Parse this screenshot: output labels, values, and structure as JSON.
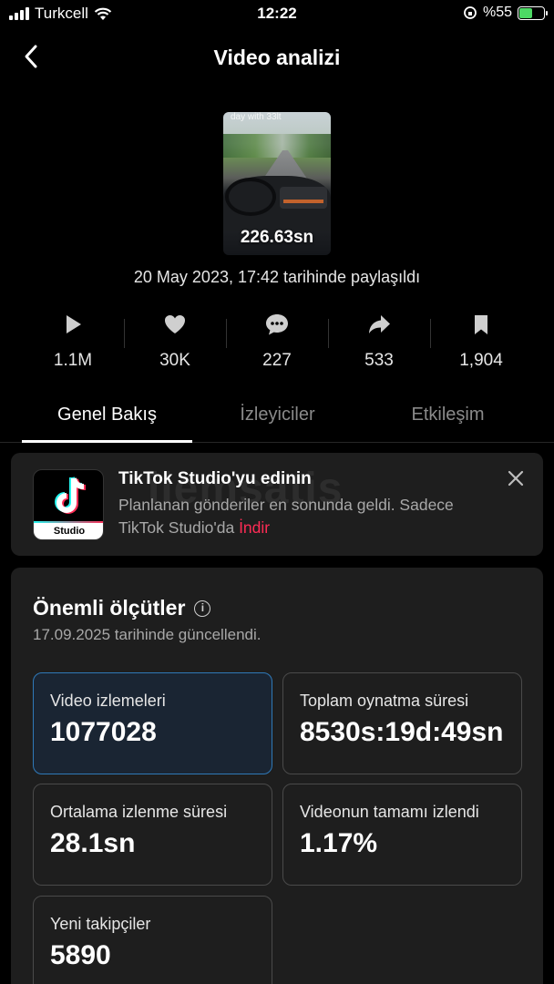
{
  "status_bar": {
    "carrier": "Turkcell",
    "time": "12:22",
    "battery": "%55"
  },
  "header": {
    "title": "Video analizi"
  },
  "video": {
    "overlay_text": "day with 33lt",
    "duration": "226.63sn",
    "shared_text": "20 May 2023, 17:42 tarihinde paylaşıldı"
  },
  "stats": [
    {
      "icon": "play-icon",
      "value": "1.1M"
    },
    {
      "icon": "heart-icon",
      "value": "30K"
    },
    {
      "icon": "comment-icon",
      "value": "227"
    },
    {
      "icon": "share-icon",
      "value": "533"
    },
    {
      "icon": "bookmark-icon",
      "value": "1,904"
    }
  ],
  "tabs": [
    "Genel Bakış",
    "İzleyiciler",
    "Etkileşim"
  ],
  "banner": {
    "logo_label": "Studio",
    "title": "TikTok Studio'yu edinin",
    "text": "Planlanan gönderiler en sonunda geldi. Sadece TikTok Studio'da ",
    "link": "İndir",
    "watermark": "ilemsatis"
  },
  "metrics": {
    "title": "Önemli ölçütler",
    "updated": "17.09.2025 tarihinde güncellendi.",
    "items": [
      {
        "label": "Video izlemeleri",
        "value": "1077028"
      },
      {
        "label": "Toplam oynatma süresi",
        "value": "8530s:19d:49sn"
      },
      {
        "label": "Ortalama izlenme süresi",
        "value": "28.1sn"
      },
      {
        "label": "Videonun tamamı izlendi",
        "value": "1.17%"
      },
      {
        "label": "Yeni takipçiler",
        "value": "5890"
      }
    ]
  },
  "colors": {
    "accent": "#fe2c55",
    "active_border": "#2f79b8",
    "card": "#1e1e1e",
    "battery": "#4cd964"
  }
}
